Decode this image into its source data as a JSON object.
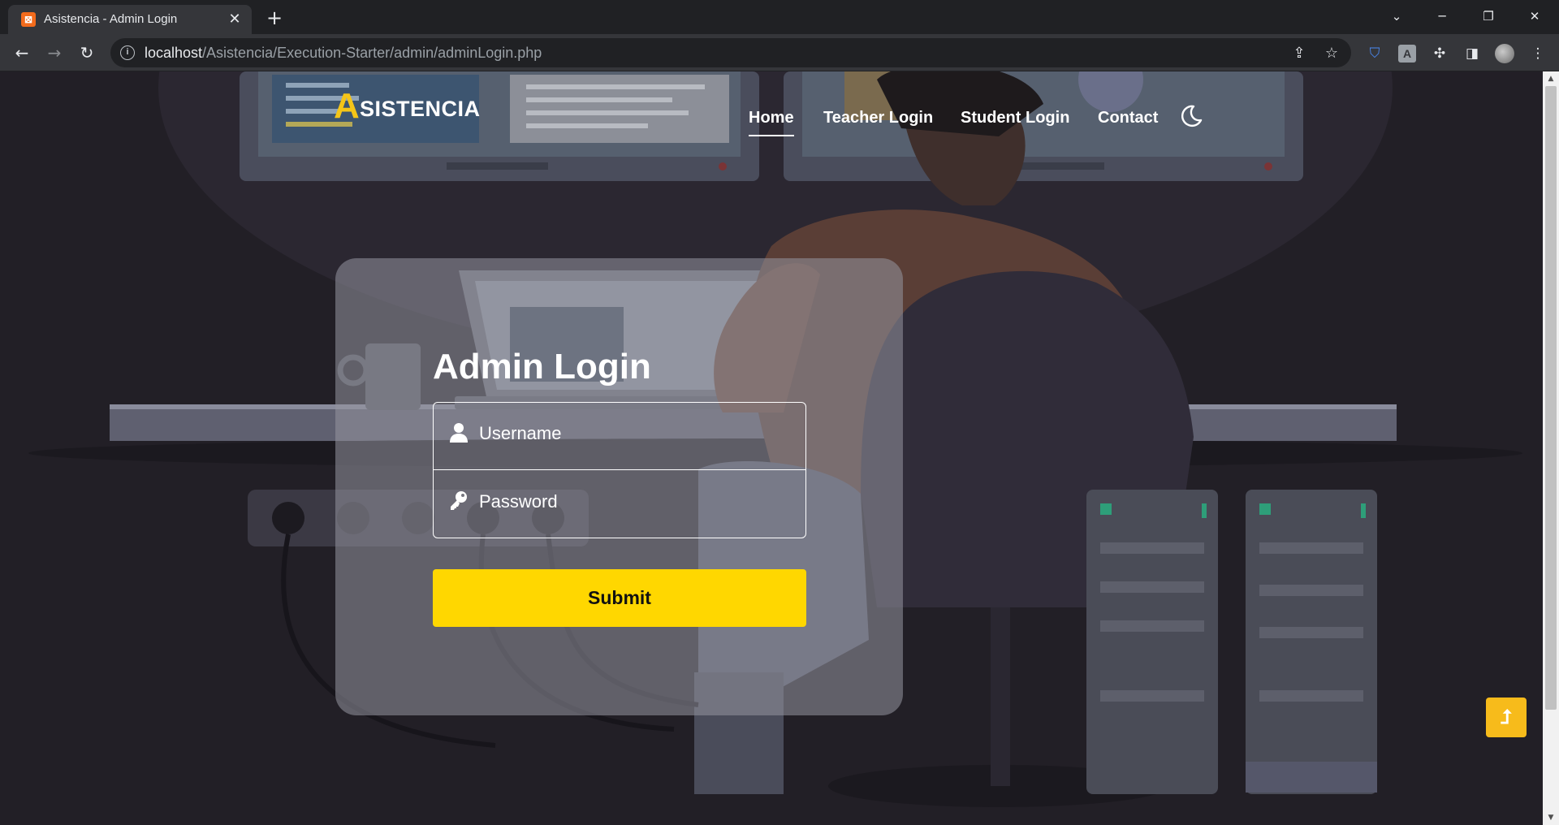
{
  "browser": {
    "tab": {
      "title": "Asistencia - Admin Login",
      "favicon": "xampp-icon",
      "close_symbol": "✕"
    },
    "new_tab_symbol": "+",
    "window_controls": {
      "dropdown": "⌄",
      "minimize": "─",
      "restore": "❐",
      "close": "✕"
    },
    "nav": {
      "back": "←",
      "forward": "→",
      "reload": "↻"
    },
    "url": {
      "host": "localhost",
      "path": "/Asistencia/Execution-Starter/admin/adminLogin.php"
    },
    "omnibox_icons": [
      "share-icon",
      "bookmark-star-icon"
    ],
    "extensions": [
      "shield-extension-icon",
      "a-extension-icon",
      "puzzle-extensions-icon",
      "side-panel-icon",
      "profile-avatar",
      "kebab-menu-icon"
    ],
    "ext_a_letter": "A"
  },
  "site": {
    "logo": {
      "first_letter": "A",
      "rest": "SISTENCIA"
    },
    "nav": [
      {
        "label": "Home",
        "active": true
      },
      {
        "label": "Teacher Login"
      },
      {
        "label": "Student Login"
      },
      {
        "label": "Contact"
      }
    ],
    "theme_toggle_icon": "moon-icon"
  },
  "login": {
    "title": "Admin Login",
    "username_placeholder": "Username",
    "password_placeholder": "Password",
    "submit_label": "Submit"
  },
  "back_to_top": {
    "symbol": "⮥",
    "icon": "back-to-top-icon"
  },
  "colors": {
    "accent_yellow": "#ffd700",
    "logo_yellow": "#f5c518",
    "back_to_top": "#f7bb1b"
  }
}
